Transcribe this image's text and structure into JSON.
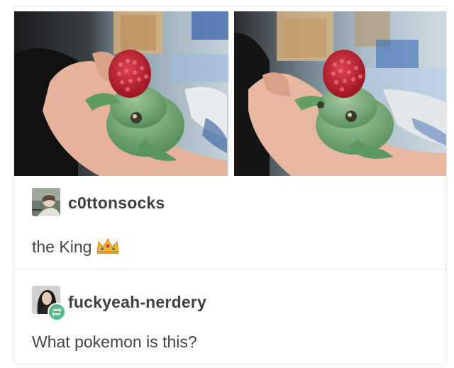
{
  "post": {
    "images": [
      {
        "icon": "frog-with-raspberry-photo"
      },
      {
        "icon": "frog-with-raspberry-photo"
      }
    ],
    "reblogs": [
      {
        "username": "c0ttonsocks",
        "avatar_icon": "avatar-icon",
        "text": "the King",
        "emoji_icon": "crown-icon"
      },
      {
        "username": "fuckyeah-nerdery",
        "avatar_icon": "avatar-icon",
        "badge_icon": "reblog-icon",
        "text": "What pokemon is this?"
      }
    ]
  },
  "colors": {
    "reblog_badge": "#56bc8a",
    "text": "#444444",
    "border": "#e6e6e6"
  }
}
